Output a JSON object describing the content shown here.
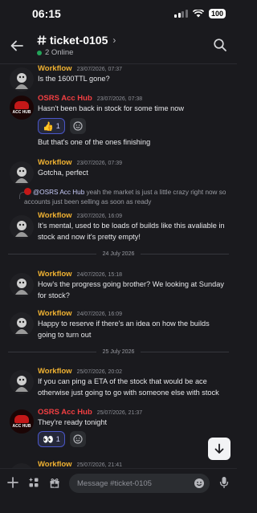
{
  "status_bar": {
    "time": "06:15",
    "battery": "100"
  },
  "header": {
    "channel": "ticket-0105",
    "online": "2 Online"
  },
  "messages": [
    {
      "author": "Workflow",
      "timestamp": "23/07/2026, 07:37",
      "lines": [
        "Is the 1600TTL gone?"
      ]
    },
    {
      "author": "OSRS Acc Hub",
      "timestamp": "23/07/2026, 07:38",
      "lines": [
        "Hasn't been back in stock for some time now"
      ],
      "reaction_count": "1",
      "followup": "But that's one of the ones finishing"
    },
    {
      "author": "Workflow",
      "timestamp": "23/07/2026, 07:39",
      "lines": [
        "Gotcha, perfect"
      ]
    },
    {
      "reply_to": "@OSRS Acc Hub",
      "reply_text": "yeah the market is just a little crazy right now so accounts just been selling as soon as ready",
      "author": "Workflow",
      "timestamp": "23/07/2026, 16:09",
      "lines": [
        "It's mental, used to be loads of builds like this avaliable in stock and now it's pretty empty!"
      ]
    },
    {
      "author": "Workflow",
      "timestamp": "24/07/2026, 15:18",
      "lines": [
        "How's the progress going brother? We looking at Sunday for stock?"
      ]
    },
    {
      "author": "Workflow",
      "timestamp": "24/07/2026, 16:09",
      "lines": [
        "Happy to reserve if there's an idea on how the builds going to turn out"
      ]
    },
    {
      "author": "Workflow",
      "timestamp": "25/07/2026, 20:02",
      "lines": [
        "If you can ping a ETA of the stock that would be ace otherwise just going to go with someone else with stock"
      ]
    },
    {
      "author": "OSRS Acc Hub",
      "timestamp": "25/07/2026, 21:37",
      "lines": [
        "They're ready tonight"
      ],
      "reaction_count": "1"
    },
    {
      "author": "Workflow",
      "timestamp": "25/07/2026, 21:41",
      "lines": []
    }
  ],
  "dividers": [
    "24 July 2026",
    "25 July 2026"
  ],
  "reactions": {
    "thumbs": "👍",
    "eyes": "👀"
  },
  "composer": {
    "placeholder": "Message #ticket-0105"
  },
  "icons": {
    "back": "arrow-left-icon",
    "search": "search-icon",
    "plus": "plus-icon",
    "apps": "apps-icon",
    "gift": "gift-icon",
    "emoji": "emoji-icon",
    "mic": "microphone-icon",
    "jump": "arrow-down-icon"
  }
}
